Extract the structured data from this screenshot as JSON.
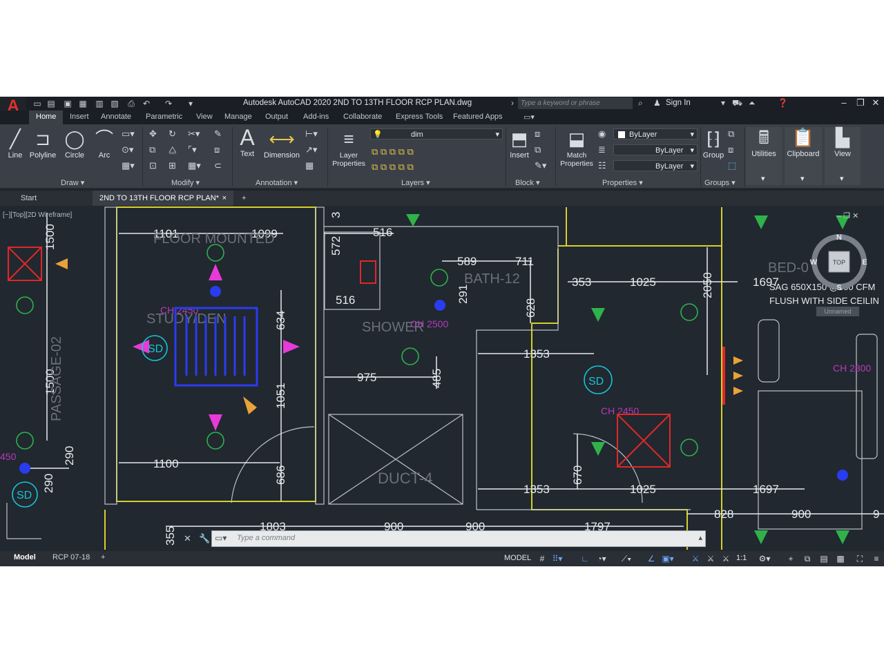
{
  "title_bar": {
    "logo": "A",
    "title": "Autodesk AutoCAD 2020    2ND TO 13TH FLOOR RCP PLAN.dwg",
    "search_placeholder": "Type a keyword or phrase",
    "sign_in": "Sign In"
  },
  "ribbon_tabs": [
    "Home",
    "Insert",
    "Annotate",
    "Parametric",
    "View",
    "Manage",
    "Output",
    "Add-ins",
    "Collaborate",
    "Express Tools",
    "Featured Apps"
  ],
  "ribbon": {
    "draw": {
      "title": "Draw",
      "line": "Line",
      "polyline": "Polyline",
      "circle": "Circle",
      "arc": "Arc"
    },
    "modify": {
      "title": "Modify"
    },
    "annotation": {
      "title": "Annotation",
      "text": "Text",
      "dimension": "Dimension"
    },
    "layers": {
      "title": "Layers",
      "layer_properties": "Layer Properties",
      "current_layer": "dim"
    },
    "block": {
      "title": "Block",
      "insert": "Insert"
    },
    "properties": {
      "title": "Properties",
      "match_properties": "Match Properties",
      "color": "ByLayer",
      "linetype": "ByLayer",
      "lineweight": "ByLayer"
    },
    "groups": {
      "title": "Groups",
      "group": "Group"
    },
    "utilities": "Utilities",
    "clipboard": "Clipboard",
    "view": "View"
  },
  "file_tabs": {
    "start": "Start",
    "active": "2ND TO 13TH FLOOR RCP PLAN*",
    "close": "×",
    "new": "+"
  },
  "viewport": {
    "label": "[−][Top][2D Wireframe]",
    "viewcube": {
      "n": "N",
      "e": "E",
      "w": "W",
      "s": "S",
      "top": "TOP",
      "ucs": "Unnamed"
    }
  },
  "drawing_text": {
    "floor_mounted": "FLOOR MOUNTED",
    "study": "STUDY/DEN",
    "ch_2450_a": "CH 2450",
    "shower": "SHOWER",
    "ch_2500": "CH 2500",
    "bath": "BATH-12",
    "bed": "BED-0",
    "sag": "SAG 650X150 @300 CFM",
    "flush": "FLUSH WITH SIDE CEILIN",
    "ch_2800": "CH 2800",
    "ch_2450_b": "CH 2450",
    "duct": "DUCT-4",
    "passage": "PASSAGE-02",
    "sd1": "SD",
    "sd2": "SD",
    "sd3": "SD",
    "ch_450": "450",
    "dims": {
      "d1101": "1101",
      "d1099": "1099",
      "d1500a": "1500",
      "d1500b": "1500",
      "d634": "634",
      "d1051": "1051",
      "d1100": "1100",
      "d686": "686",
      "d290a": "290",
      "d290b": "290",
      "d516a": "516",
      "d516b": "516",
      "d572": "572",
      "d589": "589",
      "d711": "711",
      "d291": "291",
      "d628": "628",
      "d975": "975",
      "d485": "485",
      "d353a": "353",
      "d1025a": "1025",
      "d2050": "2050",
      "d1697a": "1697",
      "d1353a": "1353",
      "d1353b": "1353",
      "d670": "670",
      "d1025b": "1025",
      "d1697b": "1697",
      "d828": "828",
      "d900a": "900",
      "d900b": "900",
      "d900c": "900",
      "d9": "9",
      "d1803": "1803",
      "d1797": "1797",
      "d355": "355",
      "d3": "3"
    }
  },
  "command_line": {
    "placeholder": "Type a command"
  },
  "layout_tabs": [
    "Model",
    "RCP 07-18"
  ],
  "status": {
    "model": "MODEL",
    "scale": "1:1"
  },
  "colors": {
    "wall": "#d8d02a",
    "dim": "#e8ebef",
    "green": "#2fb24a",
    "magenta": "#e83ad8",
    "blue": "#2a3cf0",
    "red": "#e02828",
    "cyan": "#19c4d8"
  }
}
